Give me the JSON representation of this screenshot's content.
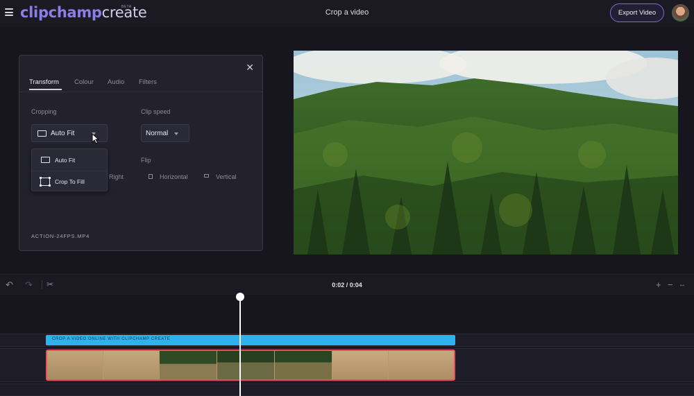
{
  "app": {
    "logo_part1": "clipchamp",
    "logo_part2": "create",
    "beta": "BETA",
    "page_title": "Crop a video",
    "export_label": "Export Video"
  },
  "panel": {
    "tabs": [
      "Transform",
      "Colour",
      "Audio",
      "Filters"
    ],
    "active_tab": "Transform",
    "cropping_label": "Cropping",
    "cropping_value": "Auto Fit",
    "clip_speed_label": "Clip speed",
    "clip_speed_value": "Normal",
    "flip_label": "Flip",
    "rotate_right": "Right",
    "flip_horizontal": "Horizontal",
    "flip_vertical": "Vertical",
    "dropdown_options": [
      "Auto Fit",
      "Crop To Fill"
    ],
    "filename": "ACTION-24FPS.MP4"
  },
  "timeline": {
    "time": "0:02 / 0:04",
    "title_clip": "CROP A VIDEO ONLINE WITH CLIPCHAMP CREATE"
  },
  "colors": {
    "accent": "#8b7ee8",
    "title_clip": "#2fb2ec",
    "video_clip_border": "#ee4d5c",
    "background": "#17161e"
  },
  "icons": [
    "hamburger-icon",
    "close-icon",
    "undo-icon",
    "redo-icon",
    "scissors-icon",
    "zoom-in-icon",
    "zoom-out-icon",
    "fit-icon",
    "caret-down-icon"
  ]
}
